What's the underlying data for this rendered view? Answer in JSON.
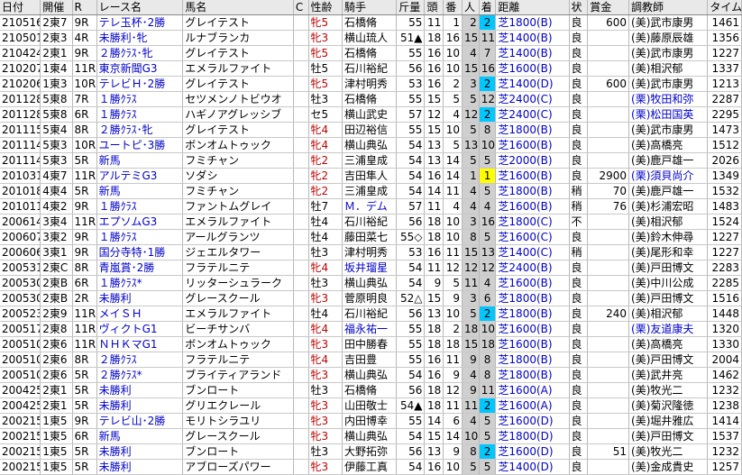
{
  "headers": [
    "日付",
    "開催",
    "R",
    "レース名",
    "馬名",
    "C",
    "性齢",
    "騎手",
    "斤量",
    "頭",
    "番",
    "人",
    "着",
    "距離",
    "状",
    "賞金",
    "調教師",
    "タイム"
  ],
  "rows": [
    [
      "210516",
      "2東7",
      "9R",
      "テレ玉杯･2勝",
      "グレイテスト",
      "",
      "牝5",
      "石橋脩",
      "55",
      "11",
      "1",
      "2",
      "2",
      "芝1800(B)",
      "良",
      "600",
      "(美)武市康男",
      "1461"
    ],
    [
      "210501",
      "2東3",
      "4R",
      "未勝利･牝",
      "ルナブランカ",
      "",
      "牝3",
      "横山琉人",
      "51▲",
      "18",
      "16",
      "15",
      "11",
      "芝1400(B)",
      "良",
      "",
      "(美)藤原辰雄",
      "1356"
    ],
    [
      "210424",
      "2東1",
      "9R",
      "２勝ｸﾗｽ･牝",
      "グレイテスト",
      "",
      "牝5",
      "石橋脩",
      "55",
      "16",
      "10",
      "4",
      "7",
      "芝1400(B)",
      "良",
      "",
      "(美)武市康男",
      "1227"
    ],
    [
      "210207",
      "1東4",
      "11R",
      "東京新聞G3",
      "エメラルファイト",
      "",
      "牡5",
      "石川裕紀",
      "56",
      "16",
      "10",
      "15",
      "16",
      "芝1600(B)",
      "良",
      "",
      "(美)相沢郁",
      "1337"
    ],
    [
      "210206",
      "1東3",
      "10R",
      "テレビＨ･2勝",
      "グレイテスト",
      "",
      "牝5",
      "津村明秀",
      "53",
      "16",
      "2",
      "3",
      "2",
      "芝1400(D)",
      "良",
      "600",
      "(美)武市康男",
      "1213"
    ],
    [
      "201128",
      "5東8",
      "7R",
      "１勝ｸﾗｽ",
      "セツメンノトビウオ",
      "",
      "牡3",
      "石橋脩",
      "55",
      "15",
      "5",
      "5",
      "12",
      "芝2400(C)",
      "良",
      "",
      "(栗)牧田和弥",
      "2287"
    ],
    [
      "201128",
      "5東8",
      "6R",
      "１勝ｸﾗｽ",
      "ハギノアグレッシブ",
      "",
      "セ5",
      "横山武史",
      "57",
      "12",
      "4",
      "12",
      "2",
      "芝2400(C)",
      "良",
      "",
      "(栗)松田国英",
      "2295"
    ],
    [
      "201115",
      "5東4",
      "8R",
      "２勝ｸﾗｽ･牝",
      "グレイテスト",
      "",
      "牝4",
      "田辺裕信",
      "55",
      "15",
      "10",
      "5",
      "8",
      "芝1800(B)",
      "良",
      "",
      "(美)武市康男",
      "1473"
    ],
    [
      "201114",
      "5東3",
      "10R",
      "ユートピ･3勝",
      "ボンオムトゥック",
      "",
      "牝4",
      "横山典弘",
      "54",
      "13",
      "5",
      "13",
      "10",
      "芝1600(B)",
      "良",
      "",
      "(美)高橋亮",
      "1512"
    ],
    [
      "201114",
      "5東3",
      "5R",
      "新馬",
      "フミチャン",
      "",
      "牝2",
      "三浦皇成",
      "54",
      "13",
      "14",
      "5",
      "5",
      "芝2000(B)",
      "良",
      "",
      "(美)鹿戸雄一",
      "2026"
    ],
    [
      "201031",
      "4東7",
      "11R",
      "アルテミG3",
      "ソダシ",
      "",
      "牝2",
      "吉田隼人",
      "54",
      "16",
      "14",
      "1",
      "1",
      "芝1600(B)",
      "良",
      "2900",
      "(栗)須貝尚介",
      "1349"
    ],
    [
      "201018",
      "4東4",
      "5R",
      "新馬",
      "フミチャン",
      "",
      "牝2",
      "三浦皇成",
      "54",
      "14",
      "11",
      "4",
      "5",
      "芝1800(B)",
      "稍",
      "70",
      "(美)鹿戸雄一",
      "1532"
    ],
    [
      "201011",
      "4東2",
      "9R",
      "１勝ｸﾗｽ",
      "ファントムグレイ",
      "",
      "牡7",
      "Ｍ．デム",
      "57",
      "11",
      "4",
      "4",
      "4",
      "芝1600(B)",
      "稍",
      "76",
      "(美)杉浦宏昭",
      "1483"
    ],
    [
      "200614",
      "3東4",
      "11R",
      "エプソムG3",
      "エメラルファイト",
      "",
      "牡4",
      "石川裕紀",
      "56",
      "18",
      "10",
      "3",
      "16",
      "芝1800(C)",
      "不",
      "",
      "(美)相沢郁",
      "1524"
    ],
    [
      "200607",
      "3東2",
      "9R",
      "１勝ｸﾗｽ",
      "アールグランツ",
      "",
      "牡4",
      "藤田菜七",
      "55◇",
      "18",
      "10",
      "8",
      "5",
      "芝1600(C)",
      "良",
      "",
      "(美)鈴木伸尋",
      "1227"
    ],
    [
      "200606",
      "3東1",
      "9R",
      "国分寺特･1勝",
      "ジェエルタワー",
      "",
      "牡3",
      "津村明秀",
      "53",
      "16",
      "11",
      "15",
      "13",
      "芝1400(C)",
      "稍",
      "",
      "(美)尾形和幸",
      "1227"
    ],
    [
      "200531",
      "2東C",
      "8R",
      "青嵐賞･2勝",
      "フラテルニテ",
      "",
      "牝4",
      "坂井瑠星",
      "54",
      "11",
      "12",
      "12",
      "12",
      "芝2400(B)",
      "良",
      "",
      "(美)戸田博文",
      "2283"
    ],
    [
      "200530",
      "2東B",
      "6R",
      "１勝ｸﾗｽ*",
      "リッターシュラーク",
      "",
      "牡3",
      "横山典弘",
      "54",
      "9",
      "5",
      "11",
      "4",
      "芝1600(B)",
      "良",
      "",
      "(美)中川公成",
      "2285"
    ],
    [
      "200530",
      "2東B",
      "2R",
      "未勝利",
      "グレースクール",
      "",
      "牝3",
      "菅原明良",
      "52△",
      "15",
      "9",
      "3",
      "6",
      "芝1800(B)",
      "良",
      "",
      "(美)戸田博文",
      "1516"
    ],
    [
      "200523",
      "2東9",
      "11R",
      "メイＳＨ",
      "エメラルファイト",
      "",
      "牡4",
      "石川裕紀",
      "56",
      "13",
      "10",
      "5",
      "2",
      "芝1800(B)",
      "良",
      "240",
      "(美)相沢郁",
      "1448"
    ],
    [
      "200517",
      "2東8",
      "11R",
      "ヴィクトG1",
      "ビーチサンバ",
      "",
      "牝4",
      "福永祐一",
      "55",
      "18",
      "2",
      "18",
      "10",
      "芝1600(B)",
      "良",
      "",
      "(栗)友道康夫",
      "1320"
    ],
    [
      "200510",
      "2東6",
      "11R",
      "ＮＨＫマG1",
      "ボンオムトゥック",
      "",
      "牝3",
      "田中勝春",
      "55",
      "18",
      "18",
      "15",
      "18",
      "芝1600(B)",
      "良",
      "",
      "(美)高橋亮",
      "1330"
    ],
    [
      "200510",
      "2東6",
      "8R",
      "２勝ｸﾗｽ",
      "フラテルニテ",
      "",
      "牝4",
      "吉田豊",
      "55",
      "16",
      "11",
      "9",
      "8",
      "芝1800(B)",
      "良",
      "",
      "(美)戸田博文",
      "2004"
    ],
    [
      "200510",
      "2東6",
      "5R",
      "２勝ｸﾗｽ*",
      "ブライティアランド",
      "",
      "牝3",
      "横山典弘",
      "54",
      "16",
      "9",
      "4",
      "8",
      "芝1800(B)",
      "良",
      "",
      "(美)武井亮",
      "1462"
    ],
    [
      "200425",
      "2東1",
      "5R",
      "未勝利",
      "ブンロート",
      "",
      "牡3",
      "石橋脩",
      "56",
      "18",
      "12",
      "9",
      "11",
      "芝1600(A)",
      "良",
      "",
      "(美)牧光二",
      "1232"
    ],
    [
      "200425",
      "2東1",
      "5R",
      "未勝利",
      "グリエクレール",
      "",
      "牝3",
      "山田敬士",
      "54▲",
      "18",
      "11",
      "11",
      "2",
      "芝1600(A)",
      "良",
      "",
      "(美)菊沢隆徳",
      "1238"
    ],
    [
      "200215",
      "1東5",
      "9R",
      "テレビ山･2勝",
      "モリトシラユリ",
      "",
      "牝3",
      "内田博幸",
      "55",
      "14",
      "6",
      "4",
      "5",
      "芝1600(D)",
      "良",
      "",
      "(美)堀井雅広",
      "1414"
    ],
    [
      "200215",
      "1東5",
      "6R",
      "新馬",
      "グレースクール",
      "",
      "牝3",
      "横山典弘",
      "54",
      "15",
      "14",
      "10",
      "5",
      "芝1800(D)",
      "良",
      "",
      "(美)戸田博文",
      "1537"
    ],
    [
      "200215",
      "1東5",
      "5R",
      "未勝利",
      "ブンロート",
      "",
      "牡3",
      "大野拓弥",
      "56",
      "13",
      "9",
      "8",
      "2",
      "芝1600(D)",
      "良",
      "51",
      "(美)牧光二",
      "1232"
    ],
    [
      "200215",
      "1東5",
      "5R",
      "未勝利",
      "アブローズパワー",
      "",
      "牝3",
      "伊藤工真",
      "54",
      "16",
      "10",
      "5",
      "5",
      "芝1400(D)",
      "良",
      "",
      "(美)金成貴史",
      "1257"
    ]
  ],
  "colors": {
    "header_bg": "#e9e9e9",
    "rank_bg": "#cfcfcf",
    "finish_2_bg": "#00c8ff",
    "finish_1_bg": "#ffff00",
    "blue_text": "#0000cc"
  }
}
